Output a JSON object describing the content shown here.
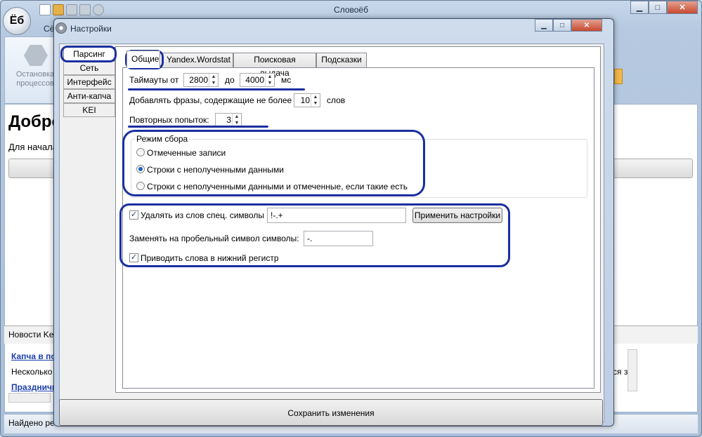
{
  "app": {
    "title": "Словоёб",
    "logo_text": "Ёб",
    "ribbon_label": "Остановка процессов",
    "welcome_heading": "Добро",
    "welcome_sub": "Для начала",
    "news_header": "Новости Ke",
    "news_items": [
      "Капча в по",
      "Несколько",
      "Праздничн"
    ],
    "news_right_fragment": "ся з",
    "status_text": "Найдено ре"
  },
  "dialog": {
    "title_prefix": "Сё",
    "title": "Настройки",
    "sidebar": [
      "Парсинг",
      "Сеть",
      "Интерфейс",
      "Анти-капча",
      "KEI"
    ],
    "tabs": [
      "Общие",
      "Yandex.Wordstat",
      "Поисковая выдача",
      "Подсказки"
    ],
    "general": {
      "timeouts_label": "Таймауты от",
      "timeout_from": "2800",
      "timeout_to_label": "до",
      "timeout_to": "4000",
      "timeout_unit": "мс",
      "add_phrases_label": "Добавлять фразы, содержащие не более",
      "max_words": "10",
      "words_unit": "слов",
      "retries_label": "Повторных попыток:",
      "retries": "3",
      "mode_group_title": "Режим сбора",
      "mode_options": [
        "Отмеченные записи",
        "Строки с неполученными данными",
        "Строки с неполученными данными и отмеченные, если такие есть"
      ],
      "mode_selected": 1,
      "remove_special_label": "Удалять из слов спец. символы",
      "remove_special_checked": true,
      "remove_special_value": "!-.+",
      "apply_button": "Применить настройки",
      "replace_label": "Заменять на пробельный символ символы:",
      "replace_value": "-.",
      "lowercase_label": "Приводить слова в нижний регистр",
      "lowercase_checked": true
    },
    "save_button": "Сохранить изменения"
  },
  "colors": {
    "marker": "#1a2fa0",
    "radio_dot": "#1f5fbf"
  }
}
